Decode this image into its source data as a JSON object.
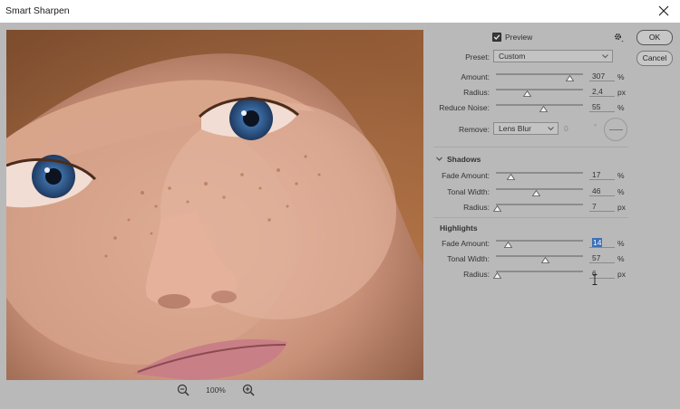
{
  "window": {
    "title": "Smart Sharpen"
  },
  "buttons": {
    "ok": "OK",
    "cancel": "Cancel"
  },
  "preview": {
    "label": "Preview",
    "checked": true
  },
  "zoom": {
    "level": "100%"
  },
  "preset": {
    "label": "Preset:",
    "value": "Custom"
  },
  "main": {
    "amount": {
      "label": "Amount:",
      "value": "307",
      "unit": "%",
      "fraction": 0.85
    },
    "radius": {
      "label": "Radius:",
      "value": "2,4",
      "unit": "px",
      "fraction": 0.36
    },
    "reduce_noise": {
      "label": "Reduce Noise:",
      "value": "55",
      "unit": "%",
      "fraction": 0.55
    }
  },
  "remove": {
    "label": "Remove:",
    "value": "Lens Blur",
    "angle": "0",
    "angle_unit": "°"
  },
  "shadows": {
    "title": "Shadows",
    "fade_amount": {
      "label": "Fade Amount:",
      "value": "17",
      "unit": "%",
      "fraction": 0.17
    },
    "tonal_width": {
      "label": "Tonal Width:",
      "value": "46",
      "unit": "%",
      "fraction": 0.46
    },
    "radius": {
      "label": "Radius:",
      "value": "7",
      "unit": "px",
      "fraction": 0.02
    }
  },
  "highlights": {
    "title": "Highlights",
    "fade_amount": {
      "label": "Fade Amount:",
      "value": "14",
      "unit": "%",
      "fraction": 0.14
    },
    "tonal_width": {
      "label": "Tonal Width:",
      "value": "57",
      "unit": "%",
      "fraction": 0.57
    },
    "radius": {
      "label": "Radius:",
      "value": "6",
      "unit": "px",
      "fraction": 0.02
    }
  },
  "colors": {
    "panel": "#b9b9b9",
    "selection": "#3c6fb6",
    "accent_dark": "#3a3a3a"
  }
}
